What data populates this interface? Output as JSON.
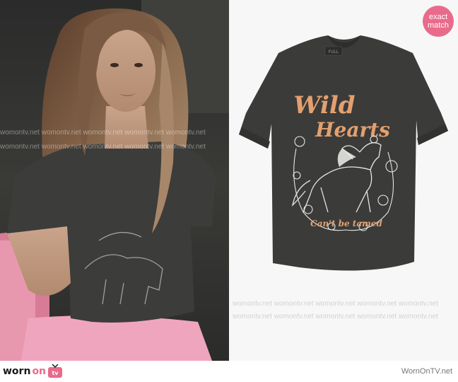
{
  "watermark": {
    "text": "womontv.net",
    "rows": [
      "womontv.net  womontv.net  womontv.net  womontv.net  womontv.net",
      "womontv.net  womontv.net  womontv.net  womontv.net  womontv.net"
    ]
  },
  "badge": {
    "line1": "exact",
    "line2": "match",
    "color": "#e86b8b"
  },
  "product": {
    "tag_label": "FULL",
    "graphic_title_1": "Wild",
    "graphic_title_2": "Hearts",
    "graphic_tagline": "Can't be tamed",
    "shirt_color": "#3b3b3a",
    "print_color": "#e3a06e"
  },
  "footer": {
    "logo_word_1": "worn",
    "logo_word_2": "on",
    "logo_tv": "tv",
    "credit": "WornOnTV.net"
  }
}
